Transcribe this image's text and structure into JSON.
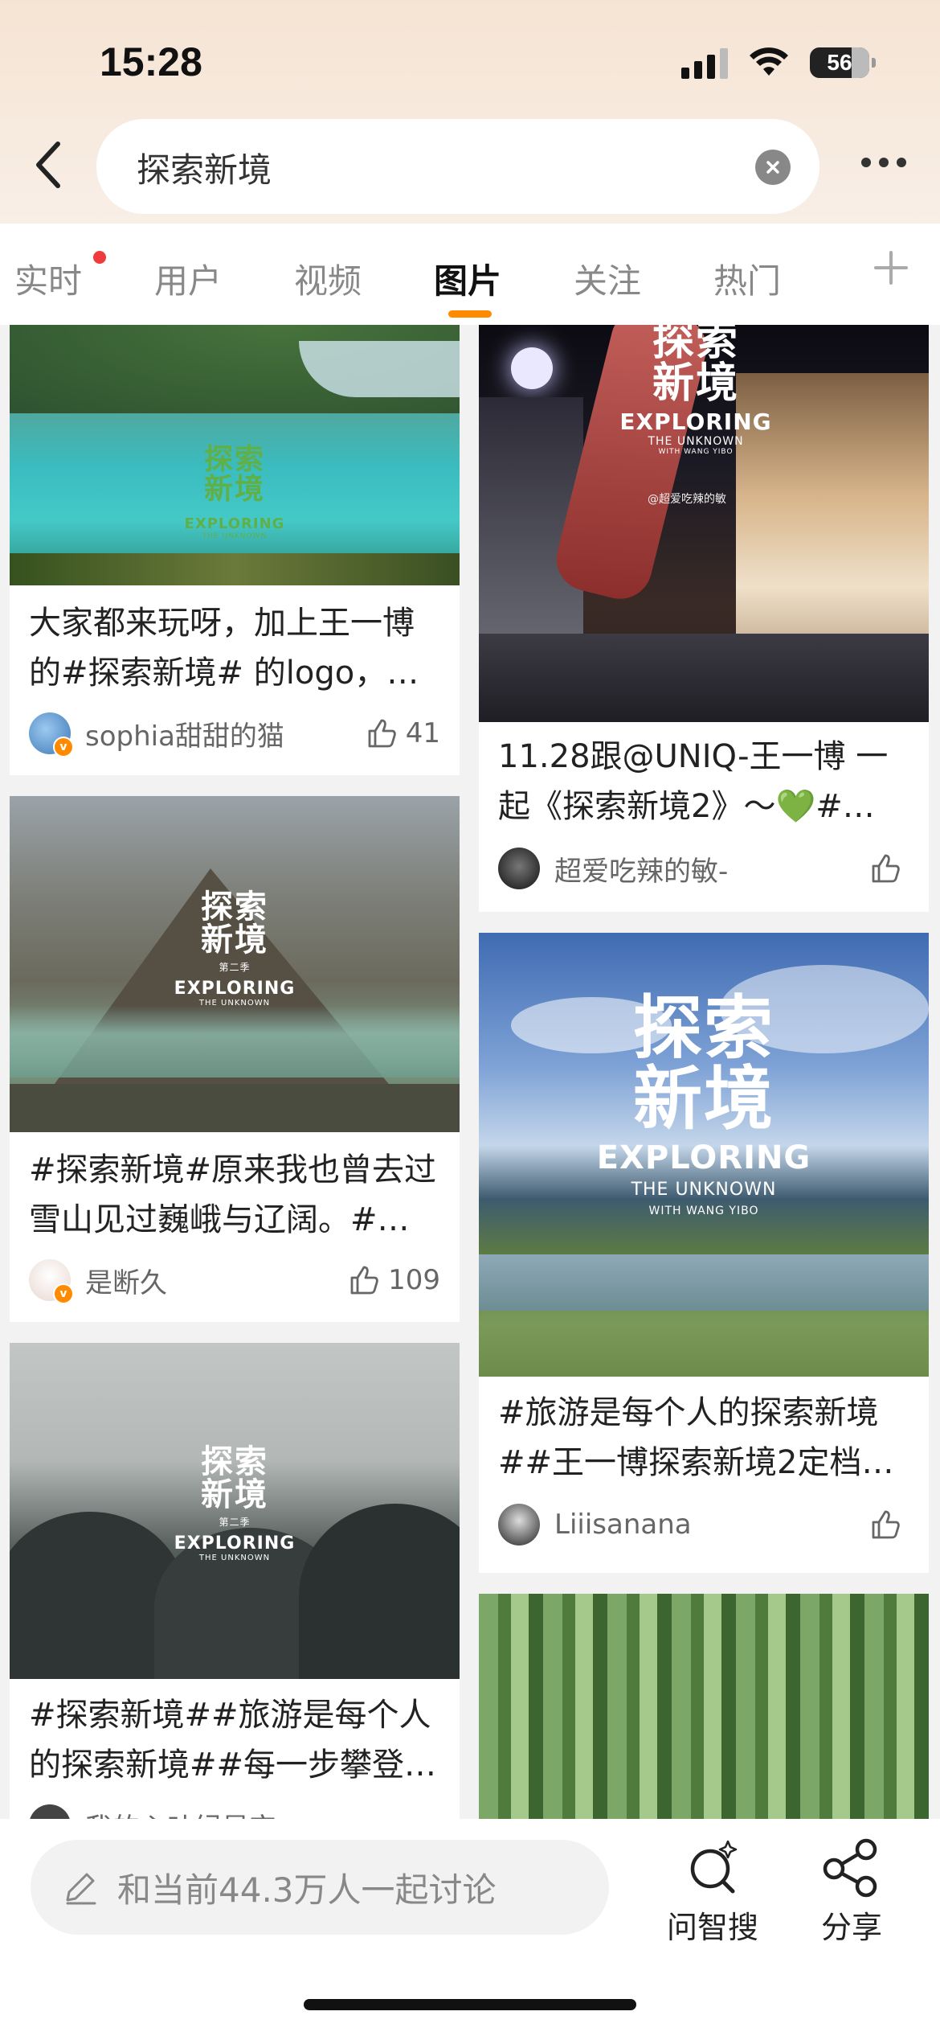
{
  "status": {
    "time": "15:28",
    "battery": "56"
  },
  "search": {
    "query": "探索新境"
  },
  "tabs": [
    {
      "label": "实时"
    },
    {
      "label": "用户"
    },
    {
      "label": "视频"
    },
    {
      "label": "图片"
    },
    {
      "label": "关注"
    },
    {
      "label": "热门"
    }
  ],
  "active_tab": "图片",
  "feed": {
    "brand_cn_1": "探索",
    "brand_cn_2": "新境",
    "brand_en": "EXPLORING",
    "brand_en_2": "THE UNKNOWN",
    "brand_sub": "WITH WANG YIBO",
    "season": "第二季",
    "watermark": "@超爱吃辣的敏",
    "left": [
      {
        "title": "大家都来玩呀，加上王一博的#探索新境# 的logo，…",
        "author": "sophia甜甜的猫",
        "likes": "41"
      },
      {
        "title": "#探索新境#原来我也曾去过雪山见过巍峨与辽阔。#…",
        "author": "是断久",
        "likes": "109"
      },
      {
        "title": "#探索新境##旅游是每个人的探索新境##每一步攀登…",
        "author": "我的心叶绿星空",
        "likes": ""
      }
    ],
    "right": [
      {
        "title": "11.28跟@UNIQ-王一博 一起《探索新境2》～💚#…",
        "author": "超爱吃辣的敏-",
        "likes": ""
      },
      {
        "title": "#旅游是每个人的探索新境##王一博探索新境2定档…",
        "author": "Liiisanana",
        "likes": ""
      }
    ]
  },
  "bottom": {
    "comment_placeholder": "和当前44.3万人一起讨论",
    "ask_label": "问智搜",
    "share_label": "分享"
  }
}
